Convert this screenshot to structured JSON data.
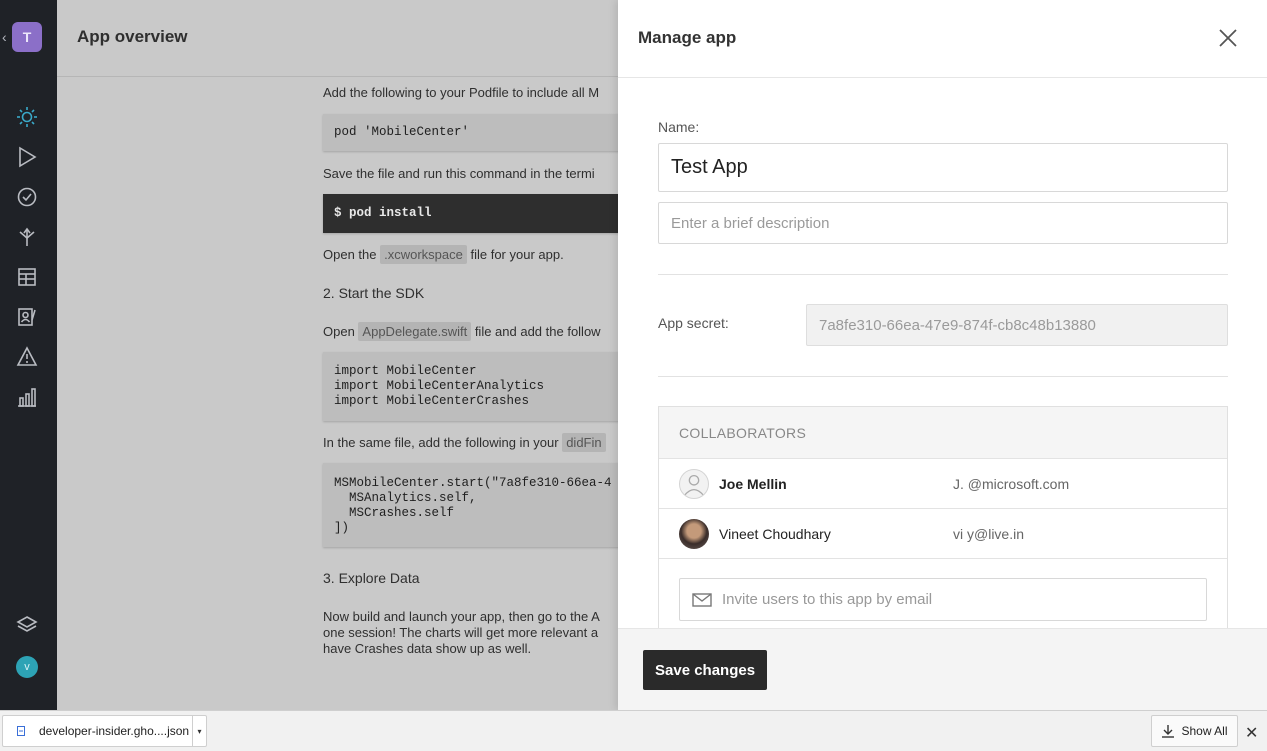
{
  "rail": {
    "back_glyph": "‹",
    "app_initial": "T",
    "user_initial": "v",
    "nav": [
      "overview-icon",
      "build-icon",
      "test-icon",
      "distribute-icon",
      "crashes-list-icon",
      "analytics-users-icon",
      "warning-icon",
      "bar-chart-icon",
      "layers-icon"
    ]
  },
  "main": {
    "title": "App overview",
    "text_podfile": "Add the following to your Podfile to include all M",
    "code_pod": "pod 'MobileCenter'",
    "text_save": "Save the file and run this command in the termi",
    "code_install": "$ pod install",
    "open_1": "Open the ",
    "chip_xcworkspace": ".xcworkspace",
    "open_2": " file for your app.",
    "h_start": "2. Start the SDK",
    "open_b1": "Open ",
    "chip_appdelegate": "AppDelegate.swift",
    "open_b2": " file and add the follow",
    "code_imports": "import MobileCenter\nimport MobileCenterAnalytics\nimport MobileCenterCrashes",
    "same_1": "In the same file, add the following in your ",
    "chip_didfin": "didFin",
    "code_start": "MSMobileCenter.start(\"7a8fe310-66ea-4\n  MSAnalytics.self,\n  MSCrashes.self\n])",
    "h_explore": "3. Explore Data",
    "explore_1": "Now build and launch your app, then go to the A",
    "explore_2": "one session! The charts will get more relevant a",
    "explore_3": "have Crashes data show up as well."
  },
  "panel": {
    "title": "Manage app",
    "name_label": "Name:",
    "name_value": "Test App",
    "desc_placeholder": "Enter a brief description",
    "secret_label": "App secret:",
    "secret_value": "7a8fe310-66ea-47e9-874f-cb8c48b13880",
    "collaborators_header": "COLLABORATORS",
    "collaborators": [
      {
        "name": "Joe Mellin",
        "email": "J.      @microsoft.com"
      },
      {
        "name": "Vineet Choudhary",
        "email": "vi                    y@live.in"
      }
    ],
    "invite_placeholder": "Invite users to this app by email",
    "save_label": "Save changes"
  },
  "downloads": {
    "file_name": "developer-insider.gho....json",
    "show_all": "Show All",
    "close_glyph": "✕"
  },
  "colors": {
    "rail_bg": "#1f2227",
    "rail_accent": "#3aa9c9",
    "app_avatar": "#8b6fc8",
    "user_avatar": "#2da3b5",
    "save_button": "#2a2a2a"
  }
}
